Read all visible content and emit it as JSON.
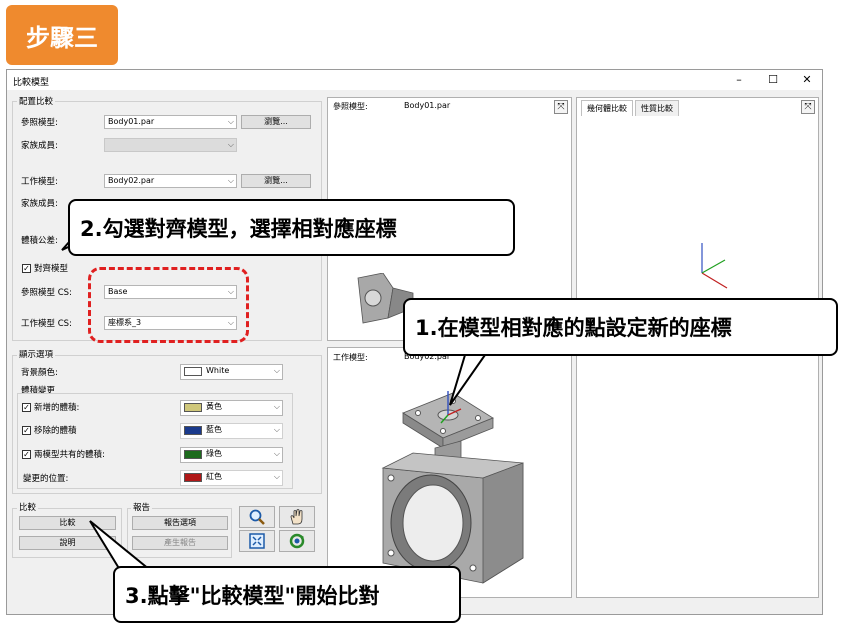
{
  "step_badge": "步驟三",
  "window": {
    "title": "比較模型",
    "controls": {
      "minimize": "–",
      "maximize": "☐",
      "close": "✕"
    }
  },
  "config": {
    "group_title": "配置比較",
    "ref_model_label": "參照模型:",
    "ref_model_value": "Body01.par",
    "browse_label": "瀏覽...",
    "family_label": "家族成員:",
    "work_model_label": "工作模型:",
    "work_model_value": "Body02.par",
    "family2_label": "家族成員:",
    "tolerance_label": "體積公差:",
    "align_label": "對齊模型",
    "ref_cs_label": "參照模型 CS:",
    "ref_cs_value": "Base",
    "work_cs_label": "工作模型 CS:",
    "work_cs_value": "座標系_3"
  },
  "display": {
    "group_title": "顯示選項",
    "bg_label": "背景顏色:",
    "bg_value": "White",
    "vol_change_title": "體積變更",
    "added_label": "新增的體積:",
    "added_color": "黃色",
    "removed_label": "移除的體積",
    "removed_color": "藍色",
    "common_label": "兩模型共有的體積:",
    "common_color": "綠色",
    "changed_label": "變更的位置:",
    "changed_color": "紅色"
  },
  "compare": {
    "group_title": "比較",
    "compare_button": "比較",
    "help_button": "說明"
  },
  "report": {
    "group_title": "報告",
    "options_button": "報告選項",
    "generate_button": "產生報告"
  },
  "panes": {
    "ref_label": "參照模型:",
    "ref_value": "Body01.par",
    "work_label": "工作模型:",
    "work_value": "Body02.par",
    "tab_geometry": "幾何體比較",
    "tab_property": "性質比較"
  },
  "callouts": {
    "step2": "2.勾選對齊模型，選擇相對應座標",
    "step1": "1.在模型相對應的點設定新的座標",
    "step3": "3.點擊\"比較模型\"開始比對"
  },
  "colors": {
    "badge": "#ef8a2e",
    "yellow": "#cfc77a",
    "blue": "#1a3a8c",
    "green": "#1d6b1d",
    "red": "#b01818",
    "dash": "#e02020"
  },
  "icons": [
    "zoom-icon",
    "pan-hand-icon",
    "fit-view-icon",
    "rotate-icon",
    "maximize-pane-icon"
  ]
}
